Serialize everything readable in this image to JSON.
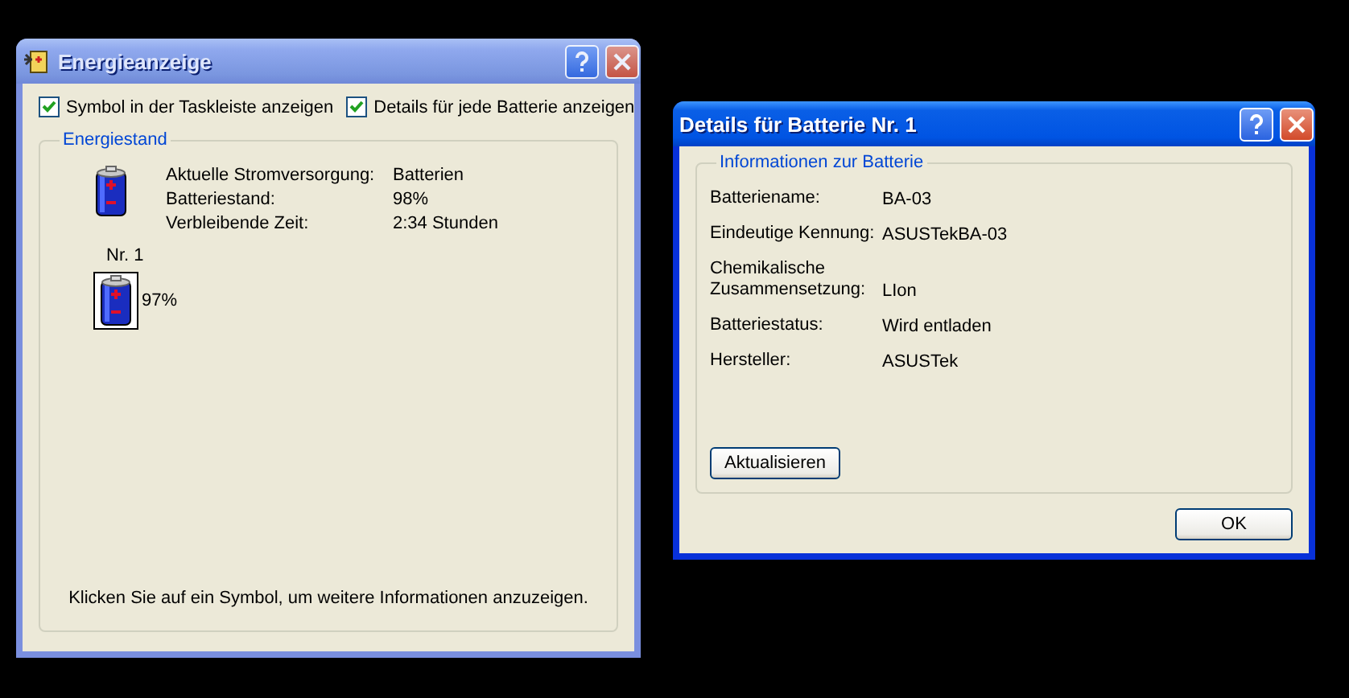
{
  "power_window": {
    "title": "Energieanzeige",
    "active": false,
    "options": [
      {
        "label": "Symbol in der Taskleiste anzeigen",
        "checked": true
      },
      {
        "label": "Details für jede Batterie anzeigen",
        "checked": true
      }
    ],
    "group": {
      "title": "Energiestand",
      "summary": [
        {
          "label": "Aktuelle Stromversorgung:",
          "value": "Batterien"
        },
        {
          "label": "Batteriestand:",
          "value": "98%"
        },
        {
          "label": "Verbleibende Zeit:",
          "value": "2:34 Stunden"
        }
      ],
      "batteries": [
        {
          "name": "Nr. 1",
          "reading": "97%",
          "selected": true
        }
      ],
      "hint": "Klicken Sie auf ein Symbol, um weitere Informationen anzuzeigen."
    }
  },
  "details_window": {
    "title": "Details für Batterie Nr. 1",
    "active": true,
    "group": {
      "title": "Informationen zur Batterie",
      "fields": [
        {
          "label": "Batteriename:",
          "value": "BA-03"
        },
        {
          "label": "Eindeutige Kennung:",
          "value": "ASUSTekBA-03"
        },
        {
          "label": "Chemikalische Zusammensetzung:",
          "value": "LIon"
        },
        {
          "label": "Batteriestatus:",
          "value": "Wird entladen"
        },
        {
          "label": "Hersteller:",
          "value": "ASUSTek"
        }
      ],
      "button": "Aktualisieren"
    },
    "buttons": [
      "OK"
    ]
  }
}
